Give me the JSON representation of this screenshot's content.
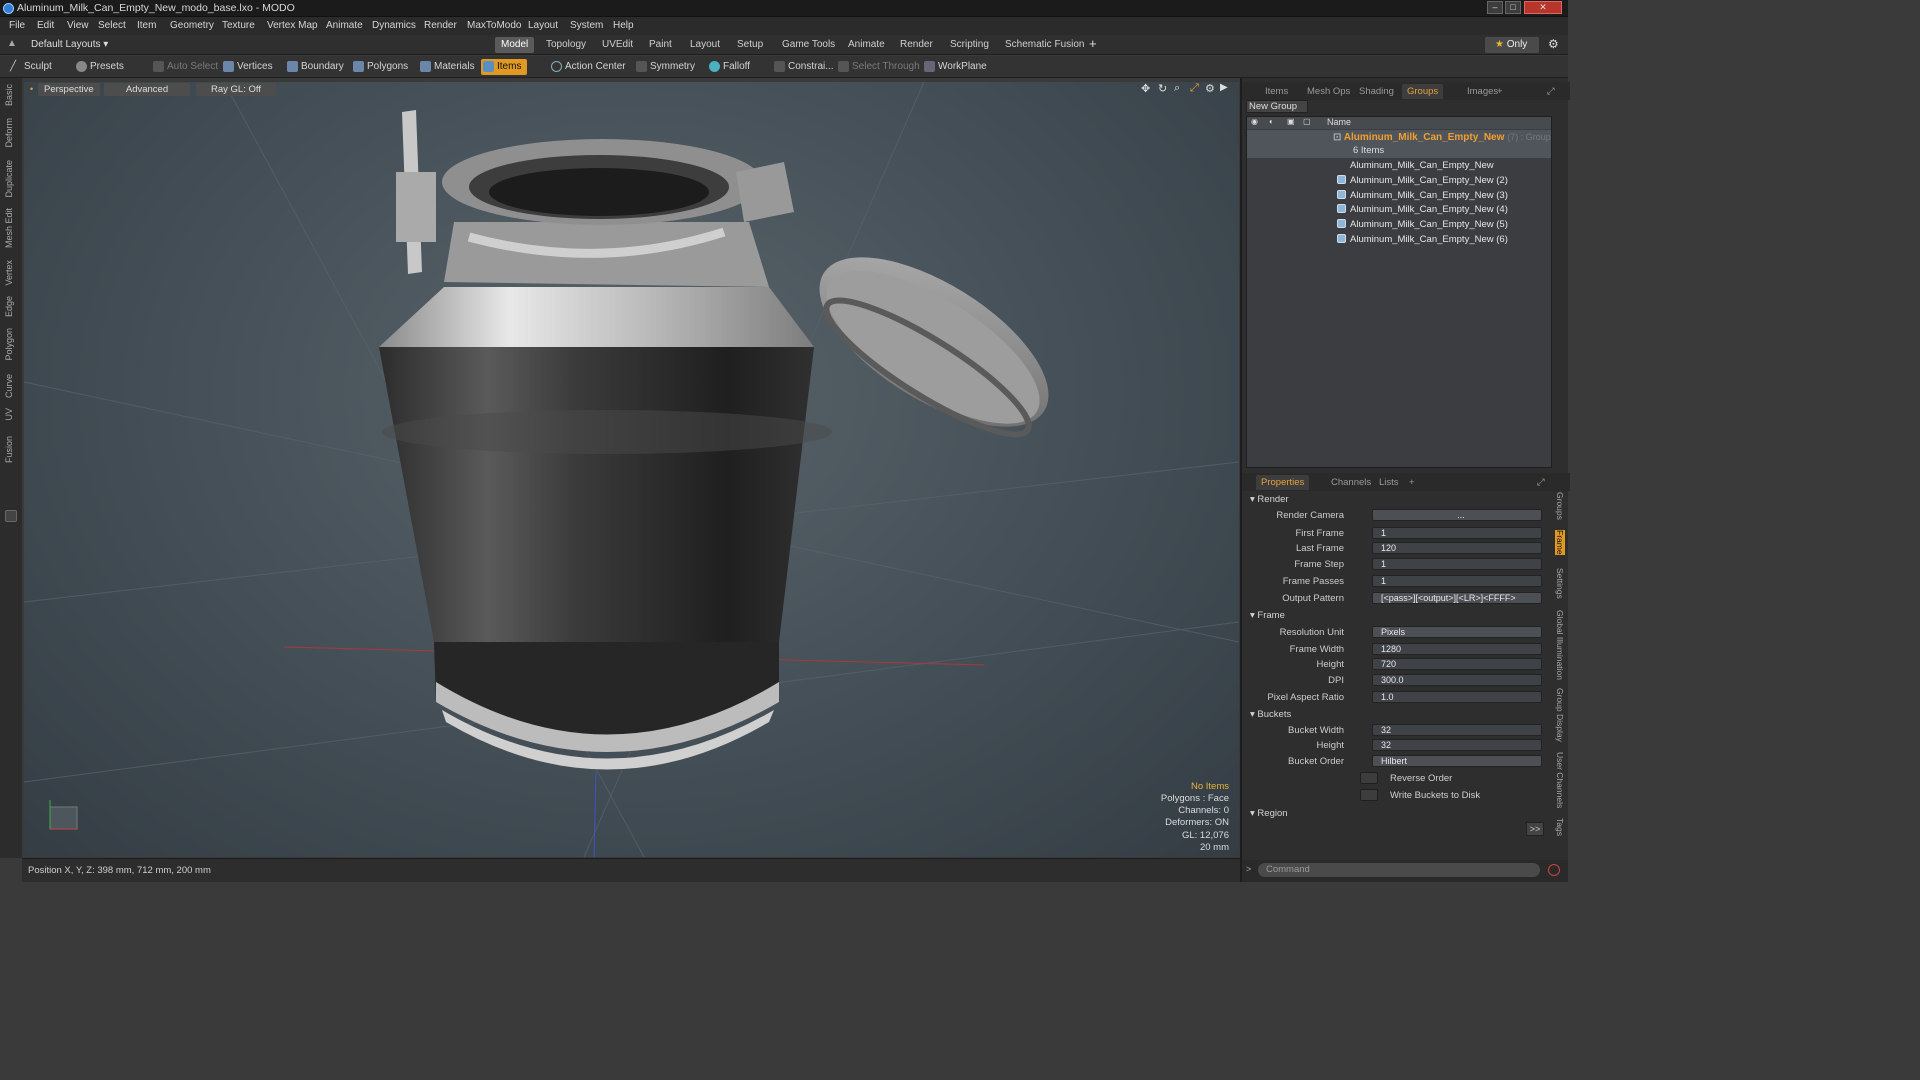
{
  "titlebar": {
    "title": "Aluminum_Milk_Can_Empty_New_modo_base.lxo - MODO"
  },
  "menu": [
    "File",
    "Edit",
    "View",
    "Select",
    "Item",
    "Geometry",
    "Texture",
    "Vertex Map",
    "Animate",
    "Dynamics",
    "Render",
    "MaxToModo",
    "Layout",
    "System",
    "Help"
  ],
  "layout_selector": "Default Layouts",
  "layout_tabs": [
    "Model",
    "Topology",
    "UVEdit",
    "Paint",
    "Layout",
    "Setup",
    "Game Tools",
    "Animate",
    "Render",
    "Scripting",
    "Schematic Fusion"
  ],
  "only_label": "Only",
  "toolbar": {
    "sculpt": "Sculpt",
    "presets": "Presets",
    "auto_select": "Auto Select",
    "vertices": "Vertices",
    "boundary": "Boundary",
    "polygons": "Polygons",
    "materials": "Materials",
    "items": "Items",
    "action_center": "Action Center",
    "symmetry": "Symmetry",
    "falloff": "Falloff",
    "constraints": "Constrai...",
    "select_through": "Select Through",
    "workplane": "WorkPlane"
  },
  "left_tabs": [
    "Basic",
    "Deform",
    "Duplicate",
    "Mesh Edit",
    "Vertex",
    "Edge",
    "Polygon",
    "Curve",
    "UV",
    "Fusion"
  ],
  "viewport": {
    "view": "Perspective",
    "mode": "Advanced",
    "raygl": "Ray GL: Off",
    "stats": {
      "no_items": "No Items",
      "polygons": "Polygons : Face",
      "channels": "Channels: 0",
      "deformers": "Deformers: ON",
      "gl": "GL: 12,076",
      "scale": "20 mm"
    }
  },
  "status": {
    "position": "Position X, Y, Z:  398 mm, 712 mm, 200 mm"
  },
  "top_panel": {
    "tabs": [
      "Items",
      "Mesh Ops",
      "Shading",
      "Groups",
      "Images"
    ],
    "new_group": "New Group",
    "column": "Name",
    "group_name": "Aluminum_Milk_Can_Empty_New",
    "group_suffix": "(7) : Group",
    "group_count": "6 Items",
    "items": [
      "Aluminum_Milk_Can_Empty_New",
      "Aluminum_Milk_Can_Empty_New (2)",
      "Aluminum_Milk_Can_Empty_New (3)",
      "Aluminum_Milk_Can_Empty_New (4)",
      "Aluminum_Milk_Can_Empty_New (5)",
      "Aluminum_Milk_Can_Empty_New (6)"
    ]
  },
  "props": {
    "tabs": [
      "Properties",
      "Channels",
      "Lists"
    ],
    "sections": {
      "render": "Render",
      "frame": "Frame",
      "buckets": "Buckets",
      "region": "Region"
    },
    "labels": {
      "render_camera": "Render Camera",
      "first_frame": "First Frame",
      "last_frame": "Last Frame",
      "frame_step": "Frame Step",
      "frame_passes": "Frame Passes",
      "output_pattern": "Output Pattern",
      "resolution_unit": "Resolution Unit",
      "frame_width": "Frame Width",
      "height": "Height",
      "dpi": "DPI",
      "pixel_aspect": "Pixel Aspect Ratio",
      "bucket_width": "Bucket Width",
      "bucket_height": "Height",
      "bucket_order": "Bucket Order",
      "reverse_order": "Reverse Order",
      "write_buckets": "Write Buckets to Disk"
    },
    "values": {
      "render_camera": "...",
      "first_frame": "1",
      "last_frame": "120",
      "frame_step": "1",
      "frame_passes": "1",
      "output_pattern": "[<pass>][<output>][<LR>]<FFFF>",
      "resolution_unit": "Pixels",
      "frame_width": "1280",
      "height": "720",
      "dpi": "300.0",
      "pixel_aspect": "1.0",
      "bucket_width": "32",
      "bucket_height": "32",
      "bucket_order": "Hilbert"
    }
  },
  "right_side_tabs": [
    "Groups",
    "Frame",
    "Settings",
    "Global Illumination",
    "Group Display",
    "User Channels",
    "Tags"
  ],
  "command_placeholder": "Command"
}
